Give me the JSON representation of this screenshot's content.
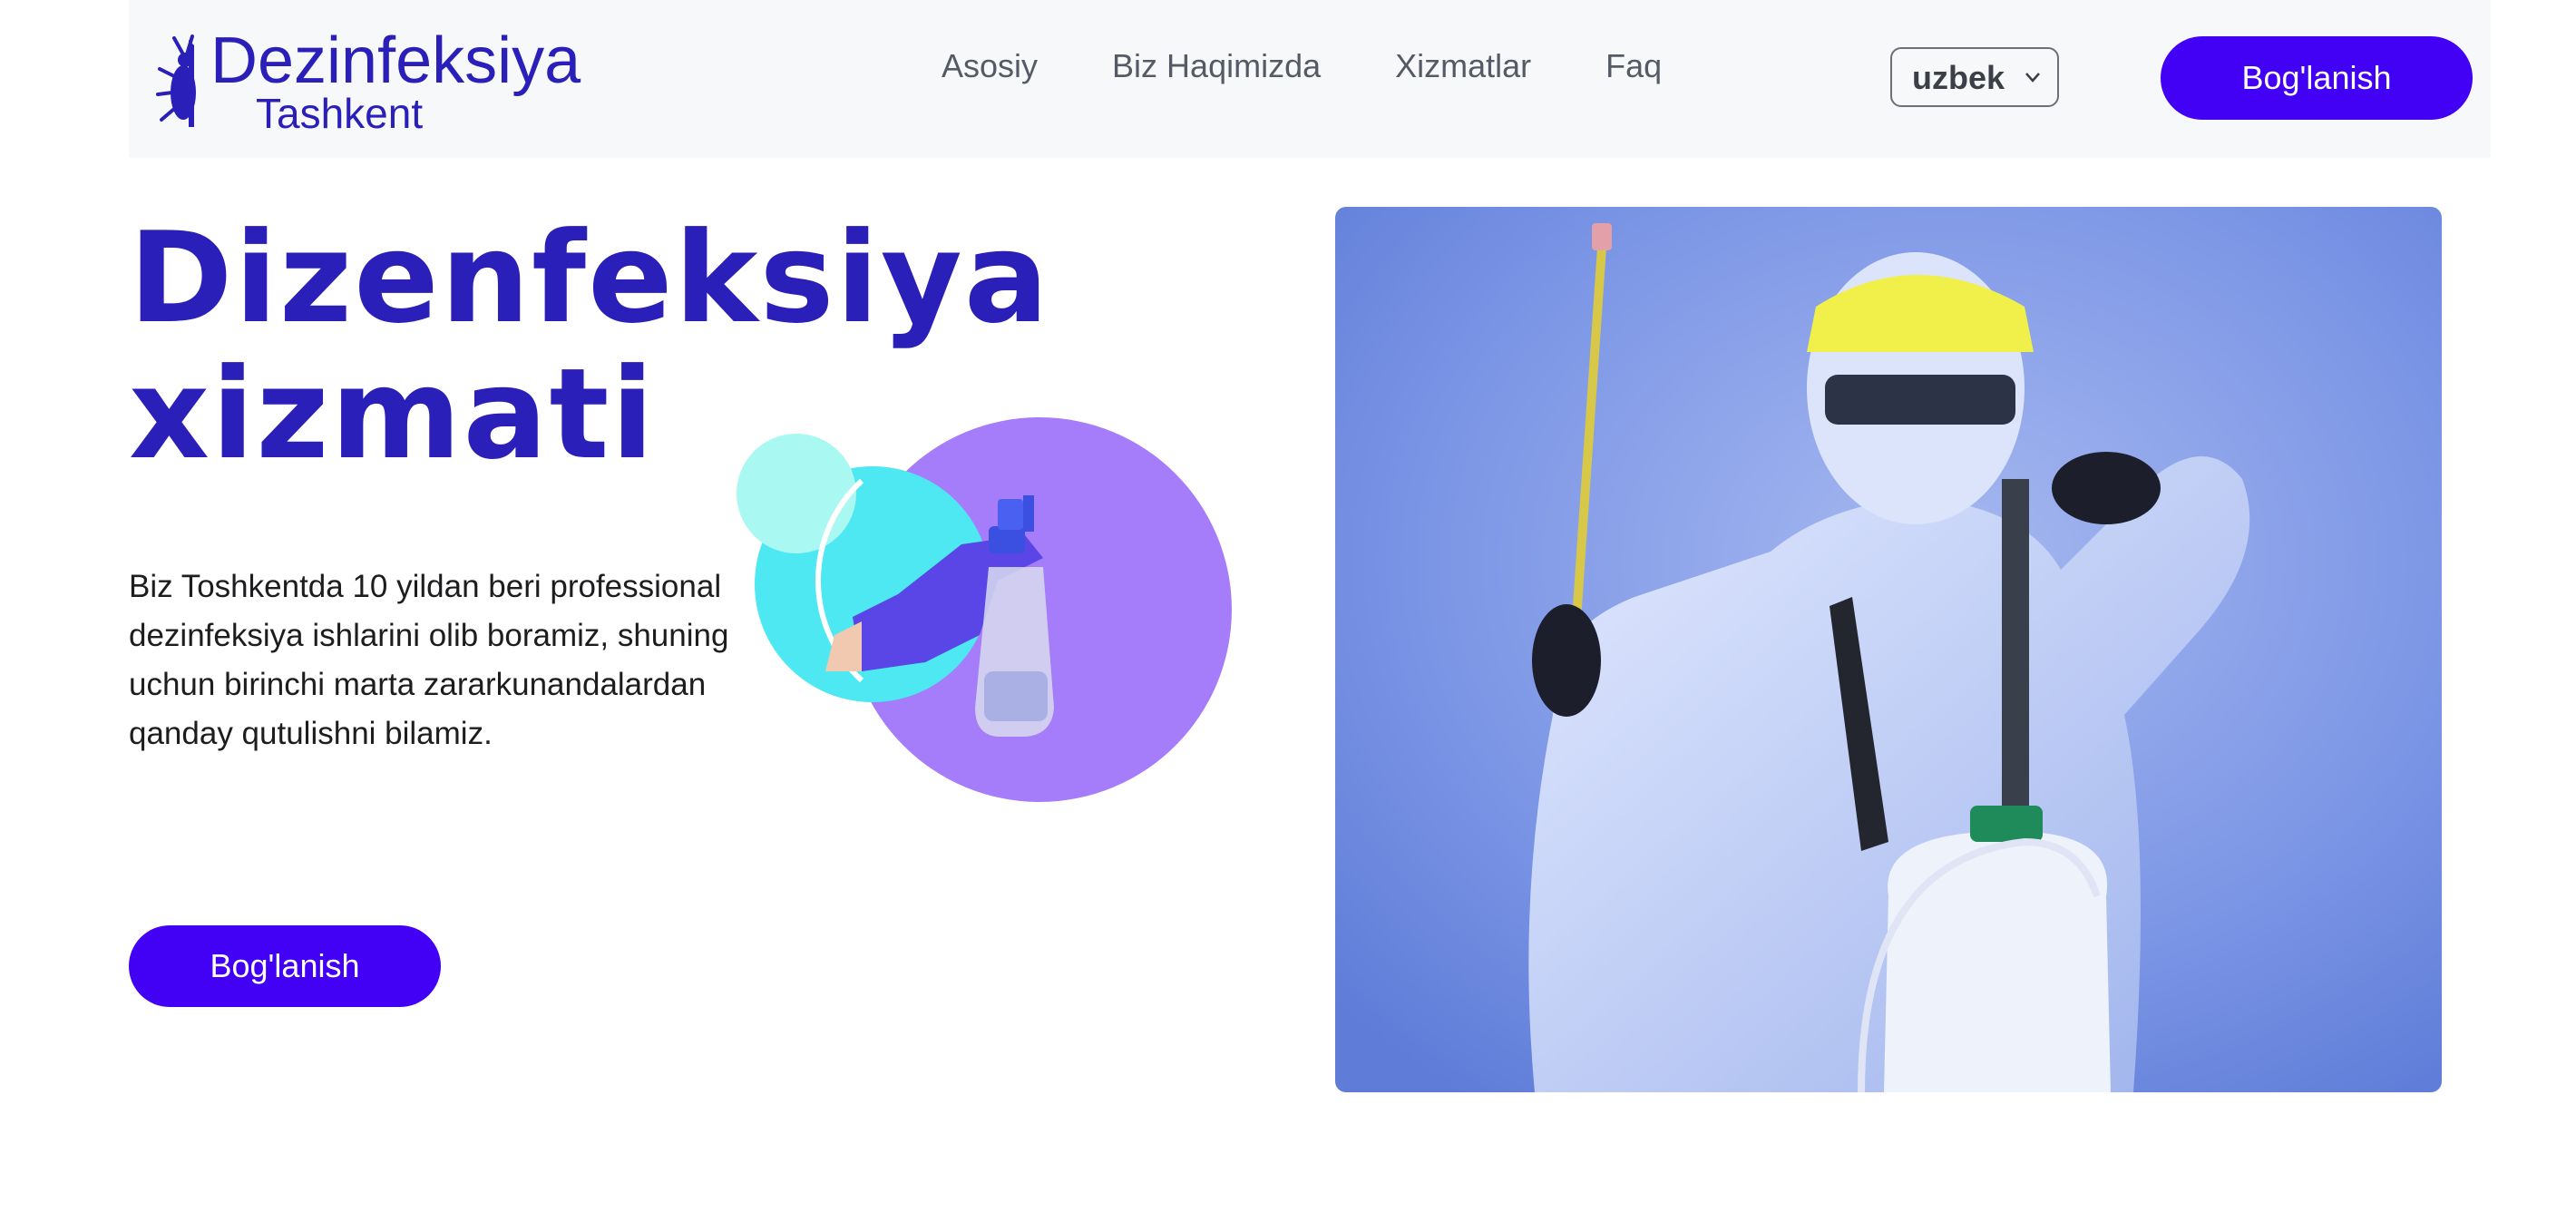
{
  "logo": {
    "title": "Dezinfeksiya",
    "subtitle": "Tashkent",
    "icon": "bug-icon"
  },
  "nav": {
    "items": [
      {
        "label": "Asosiy"
      },
      {
        "label": "Biz Haqimizda"
      },
      {
        "label": "Xizmatlar"
      },
      {
        "label": "Faq"
      }
    ]
  },
  "language": {
    "selected": "uzbek"
  },
  "header": {
    "cta_label": "Bog'lanish"
  },
  "hero": {
    "title_line1": "Dizenfeksiya",
    "title_line2": "xizmati",
    "description": "Biz Toshkentda 10 yildan beri professional dezinfeksiya ishlarini olib boramiz, shuning uchun birinchi marta zararkunandalardan qanday qutulishni bilamiz.",
    "cta_label": "Bog'lanish"
  },
  "colors": {
    "brand": "#2a1fb8",
    "button": "#4200f5",
    "header_bg": "#f7f8fa",
    "cyan": "#4de8f2",
    "light_cyan": "#a9f8f1",
    "purple": "#a57cf9"
  }
}
